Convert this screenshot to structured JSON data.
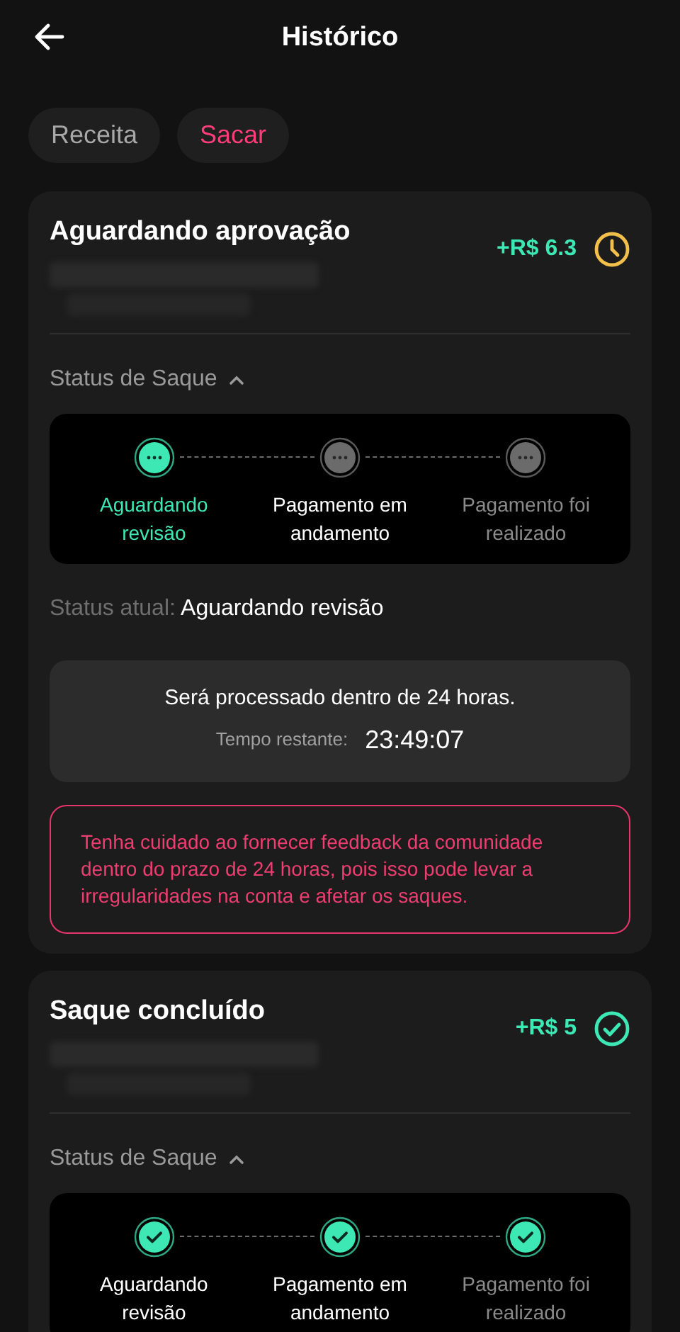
{
  "header": {
    "title": "Histórico"
  },
  "tabs": [
    {
      "label": "Receita",
      "selected": false
    },
    {
      "label": "Sacar",
      "selected": true
    }
  ],
  "records": [
    {
      "kind": "pending",
      "title": "Aguardando aprovação",
      "amount": "+R$ 6.3",
      "status_label": "Status de Saque",
      "expanded": true,
      "steps": [
        {
          "label": "Aguardando revisão",
          "kind": "active"
        },
        {
          "label": "Pagamento em andamento",
          "kind": "waiting",
          "muted": false
        },
        {
          "label": "Pagamento foi realizado",
          "kind": "waiting",
          "muted": true
        }
      ],
      "current_label": "Status atual:",
      "current_value": "Aguardando revisão",
      "notice": "Será processado dentro de 24 horas.",
      "remaining_label": "Tempo restante:",
      "remaining_value": "23:49:07",
      "warning": "Tenha cuidado ao fornecer feedback da comunidade dentro do prazo de 24 horas, pois isso pode levar a irregularidades na conta e afetar os saques."
    },
    {
      "kind": "done",
      "title": "Saque concluído",
      "amount": "+R$ 5",
      "status_label": "Status de Saque",
      "expanded": true,
      "steps": [
        {
          "label": "Aguardando revisão",
          "kind": "done",
          "muted": false
        },
        {
          "label": "Pagamento em andamento",
          "kind": "done",
          "muted": false
        },
        {
          "label": "Pagamento foi realizado",
          "kind": "done",
          "muted": true
        }
      ]
    }
  ]
}
